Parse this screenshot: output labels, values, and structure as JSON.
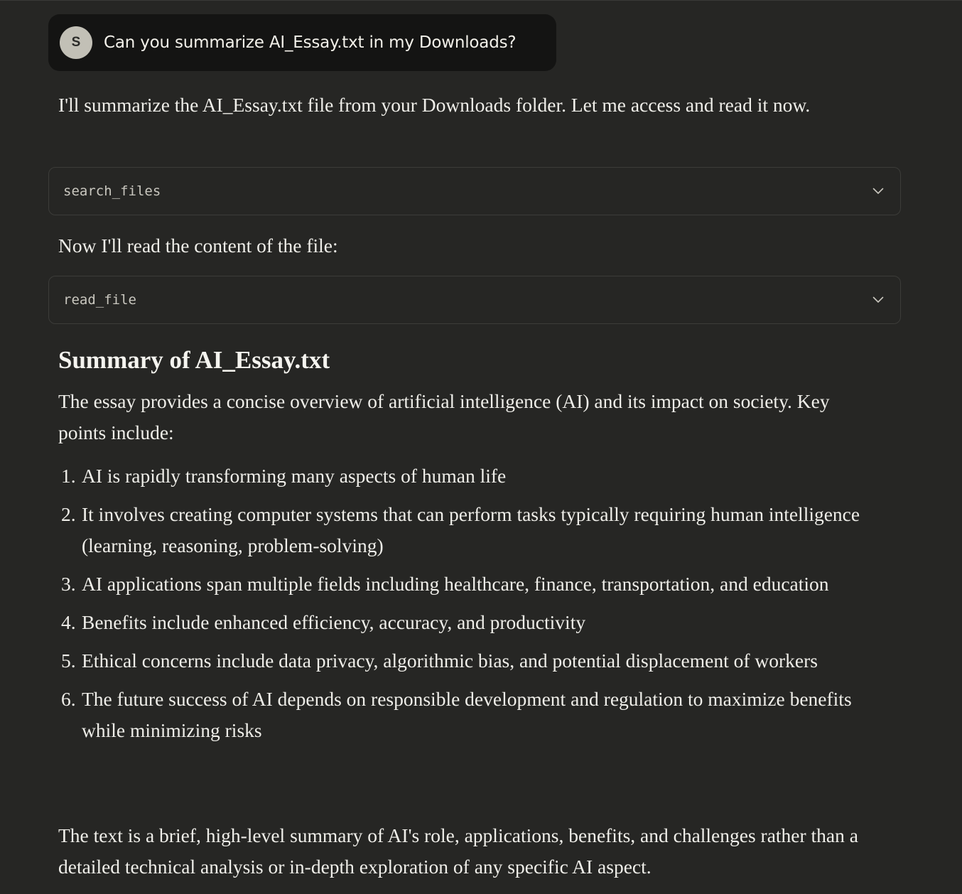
{
  "user_message": {
    "avatar_initial": "S",
    "text": "Can you summarize AI_Essay.txt in my Downloads?"
  },
  "assistant": {
    "intro": "I'll summarize the AI_Essay.txt file from your Downloads folder. Let me access and read it now.",
    "tool_calls": [
      {
        "name": "search_files",
        "icon": "chevron-down-icon"
      },
      {
        "name": "read_file",
        "icon": "chevron-down-icon"
      }
    ],
    "between_text": "Now I'll read the content of the file:",
    "summary_heading": "Summary of AI_Essay.txt",
    "summary_intro": "The essay provides a concise overview of artificial intelligence (AI) and its impact on society. Key points include:",
    "points": [
      {
        "num": "1.",
        "text": "AI is rapidly transforming many aspects of human life"
      },
      {
        "num": "2.",
        "text": "It involves creating computer systems that can perform tasks typically requiring human intelligence (learning, reasoning, problem-solving)"
      },
      {
        "num": "3.",
        "text": "AI applications span multiple fields including healthcare, finance, transportation, and education"
      },
      {
        "num": "4.",
        "text": "Benefits include enhanced efficiency, accuracy, and productivity"
      },
      {
        "num": "5.",
        "text": "Ethical concerns include data privacy, algorithmic bias, and potential displacement of workers"
      },
      {
        "num": "6.",
        "text": "The future success of AI depends on responsible development and regulation to maximize benefits while minimizing risks"
      }
    ],
    "conclusion": "The text is a brief, high-level summary of AI's role, applications, benefits, and challenges rather than a detailed technical analysis or in-depth exploration of any specific AI aspect."
  },
  "colors": {
    "background": "#262624",
    "user_bubble": "#141413",
    "avatar": "#c2c0b6",
    "text": "#efeee9",
    "tool_border": "#3c3c39"
  }
}
